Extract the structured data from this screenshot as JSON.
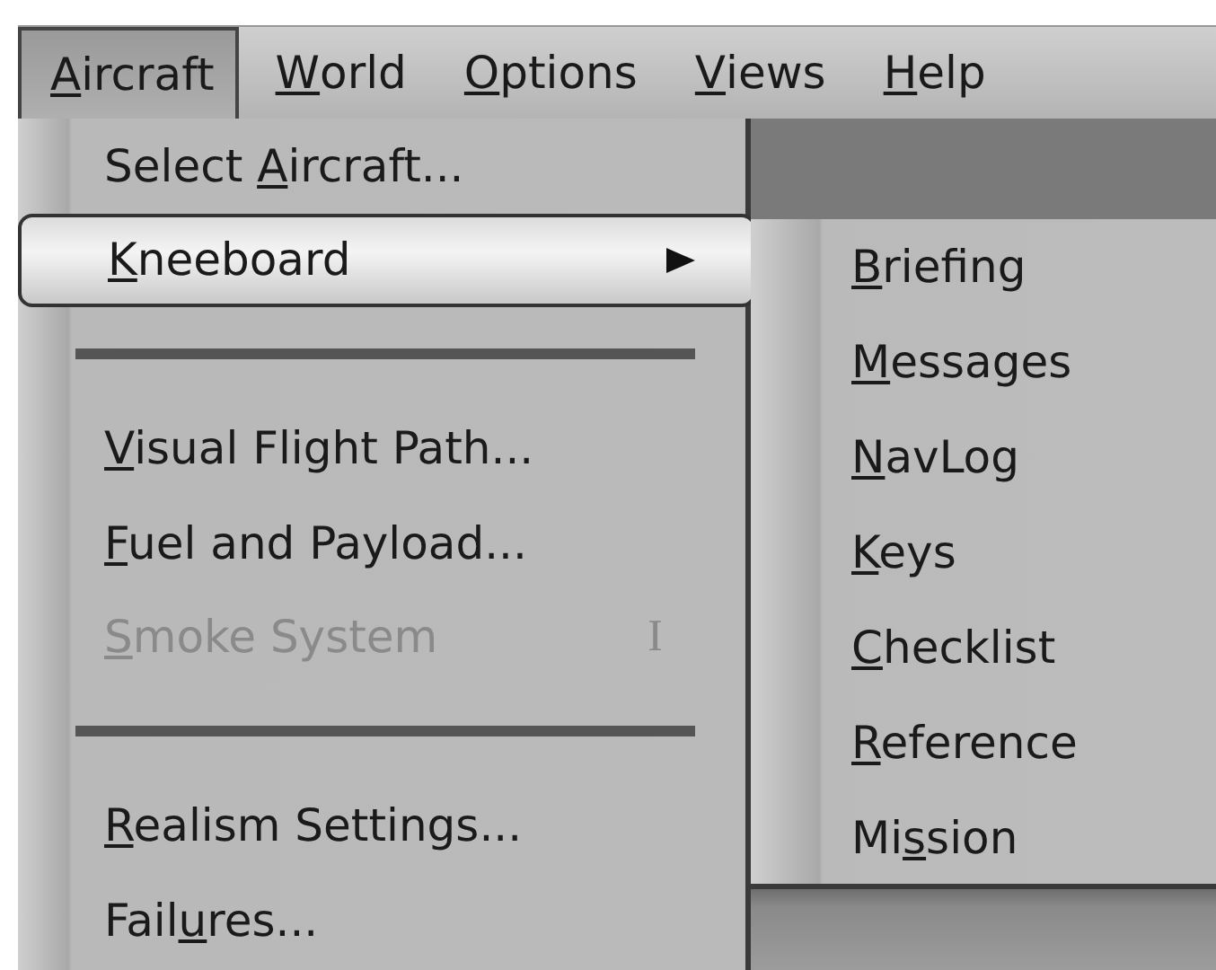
{
  "menubar": [
    {
      "key": "A",
      "post": "ircraft",
      "selected": true
    },
    {
      "key": "W",
      "post": "orld",
      "selected": false
    },
    {
      "key": "O",
      "post": "ptions",
      "selected": false
    },
    {
      "key": "V",
      "post": "iews",
      "selected": false
    },
    {
      "key": "H",
      "post": "elp",
      "selected": false
    }
  ],
  "menu": [
    {
      "kind": "command",
      "pre": "Select ",
      "key": "A",
      "post": "ircraft...",
      "selected": false,
      "disabled": false
    },
    {
      "kind": "submenu",
      "key": "K",
      "post": "neeboard",
      "selected": true,
      "disabled": false
    },
    {
      "kind": "separator"
    },
    {
      "kind": "command",
      "key": "V",
      "post": "isual Flight Path...",
      "selected": false,
      "disabled": false
    },
    {
      "kind": "command",
      "key": "F",
      "post": "uel and Payload...",
      "selected": false,
      "disabled": false
    },
    {
      "kind": "command",
      "key": "S",
      "post": "moke System",
      "shortcut": "I",
      "selected": false,
      "disabled": true
    },
    {
      "kind": "separator"
    },
    {
      "kind": "command",
      "key": "R",
      "post": "ealism Settings...",
      "selected": false,
      "disabled": false
    },
    {
      "kind": "command",
      "pre": "Fail",
      "key": "u",
      "post": "res...",
      "selected": false,
      "disabled": false
    }
  ],
  "submenu": [
    {
      "key": "B",
      "post": "riefing",
      "selected": false
    },
    {
      "key": "M",
      "post": "essages",
      "selected": false
    },
    {
      "key": "N",
      "post": "avLog",
      "selected": false
    },
    {
      "key": "K",
      "post": "eys",
      "selected": false
    },
    {
      "key": "C",
      "post": "hecklist",
      "selected": false
    },
    {
      "key": "R",
      "post": "eference",
      "selected": false
    },
    {
      "pre": "Mi",
      "key": "s",
      "post": "sion",
      "selected": false
    }
  ]
}
